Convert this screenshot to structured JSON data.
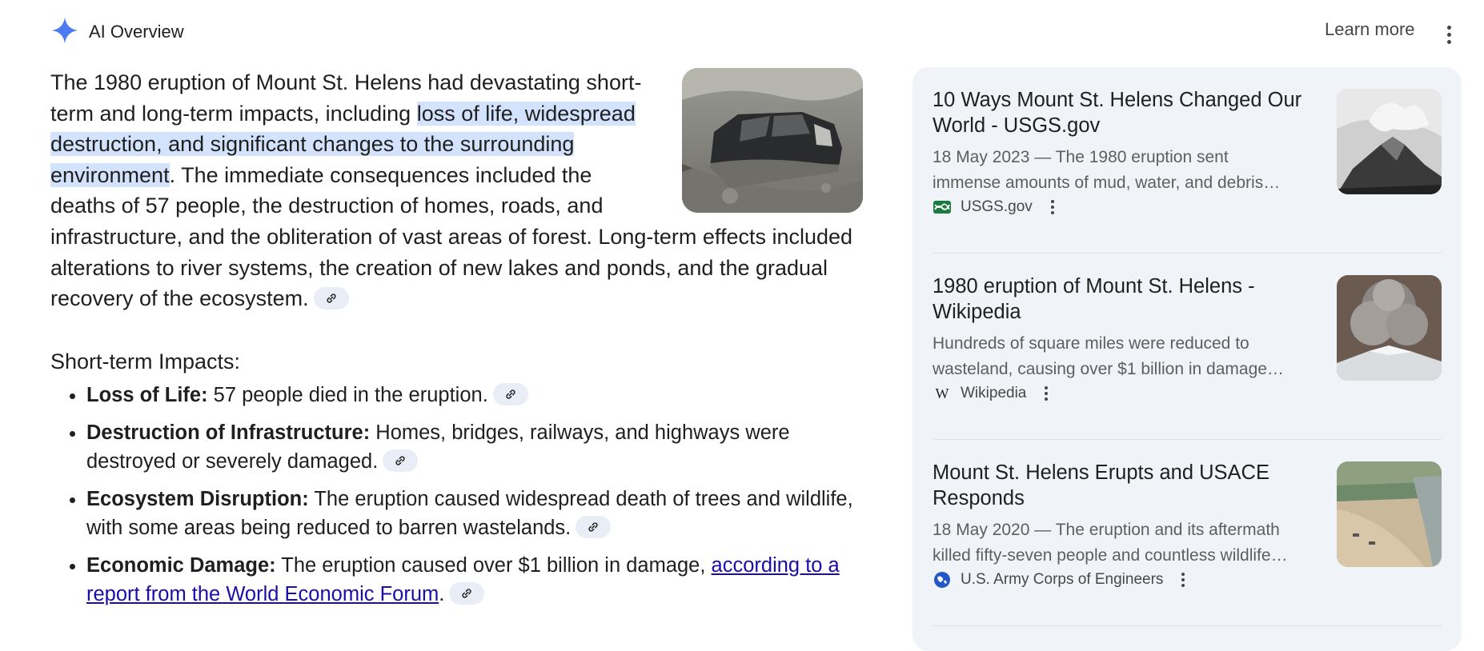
{
  "header": {
    "title": "AI Overview",
    "learn_more": "Learn more",
    "menu_icon": "more-vert-icon",
    "brand_icon": "sparkle-icon"
  },
  "overview": {
    "intro_before": "The 1980 eruption of Mount St. Helens had devastating short-term and long-term impacts, including ",
    "intro_highlight": "loss of life, widespread destruction, and significant changes to the sur­rounding environment",
    "intro_after": ". The immediate consequences in­cluded the deaths of 57 people, the destruction of homes, roads, and infrastructure, and the obliteration of vast areas of forest. Long-term effects included alterations to river systems, the creation of new lakes and ponds, and the gradual recovery of the ecosystem.",
    "image_alt": "car buried in ash",
    "section_title": "Short-term Impacts:",
    "bullets": [
      {
        "bold": "Loss of Life:",
        "text": " 57 people died in the eruption."
      },
      {
        "bold": "Destruction of Infrastructure:",
        "text": " Homes, bridges, railways, and highways were destroyed or severely damaged."
      },
      {
        "bold": "Ecosystem Disruption:",
        "text": " The eruption caused widespread death of trees and wildlife, with some areas being reduced to barren wastelands."
      },
      {
        "bold": "Economic Damage:",
        "text": " The eruption caused over $1 billion in damage, ",
        "link": "according to a report from the World Economic Forum",
        "after": "."
      }
    ],
    "cite_icon": "link-icon"
  },
  "sources": [
    {
      "title": "10 Ways Mount St. Helens Changed Our World - USGS.gov",
      "snippet_1": "18 May 2023 — The 1980 eruption sent",
      "snippet_2": "immense amounts of mud, water, and debris…",
      "source": "USGS.gov",
      "favicon": "usgs-icon"
    },
    {
      "title": "1980 eruption of Mount St. Helens - Wikipedia",
      "snippet_1": "Hundreds of square miles were reduced to",
      "snippet_2": "wasteland, causing over $1 billion in damage…",
      "source": "Wikipedia",
      "favicon": "wikipedia-icon"
    },
    {
      "title": "Mount St. Helens Erupts and USACE Responds",
      "snippet_1": "18 May 2020 — The eruption and its aftermath",
      "snippet_2": "killed fifty-seven people and countless wildlife…",
      "source": "U.S. Army Corps of Engineers",
      "favicon": "globe-icon"
    }
  ],
  "colors": {
    "highlight": "#d3e3fd",
    "panel_bg": "#f0f4f9",
    "link": "#1a0dab",
    "sparkle": "#4c7bf3"
  }
}
